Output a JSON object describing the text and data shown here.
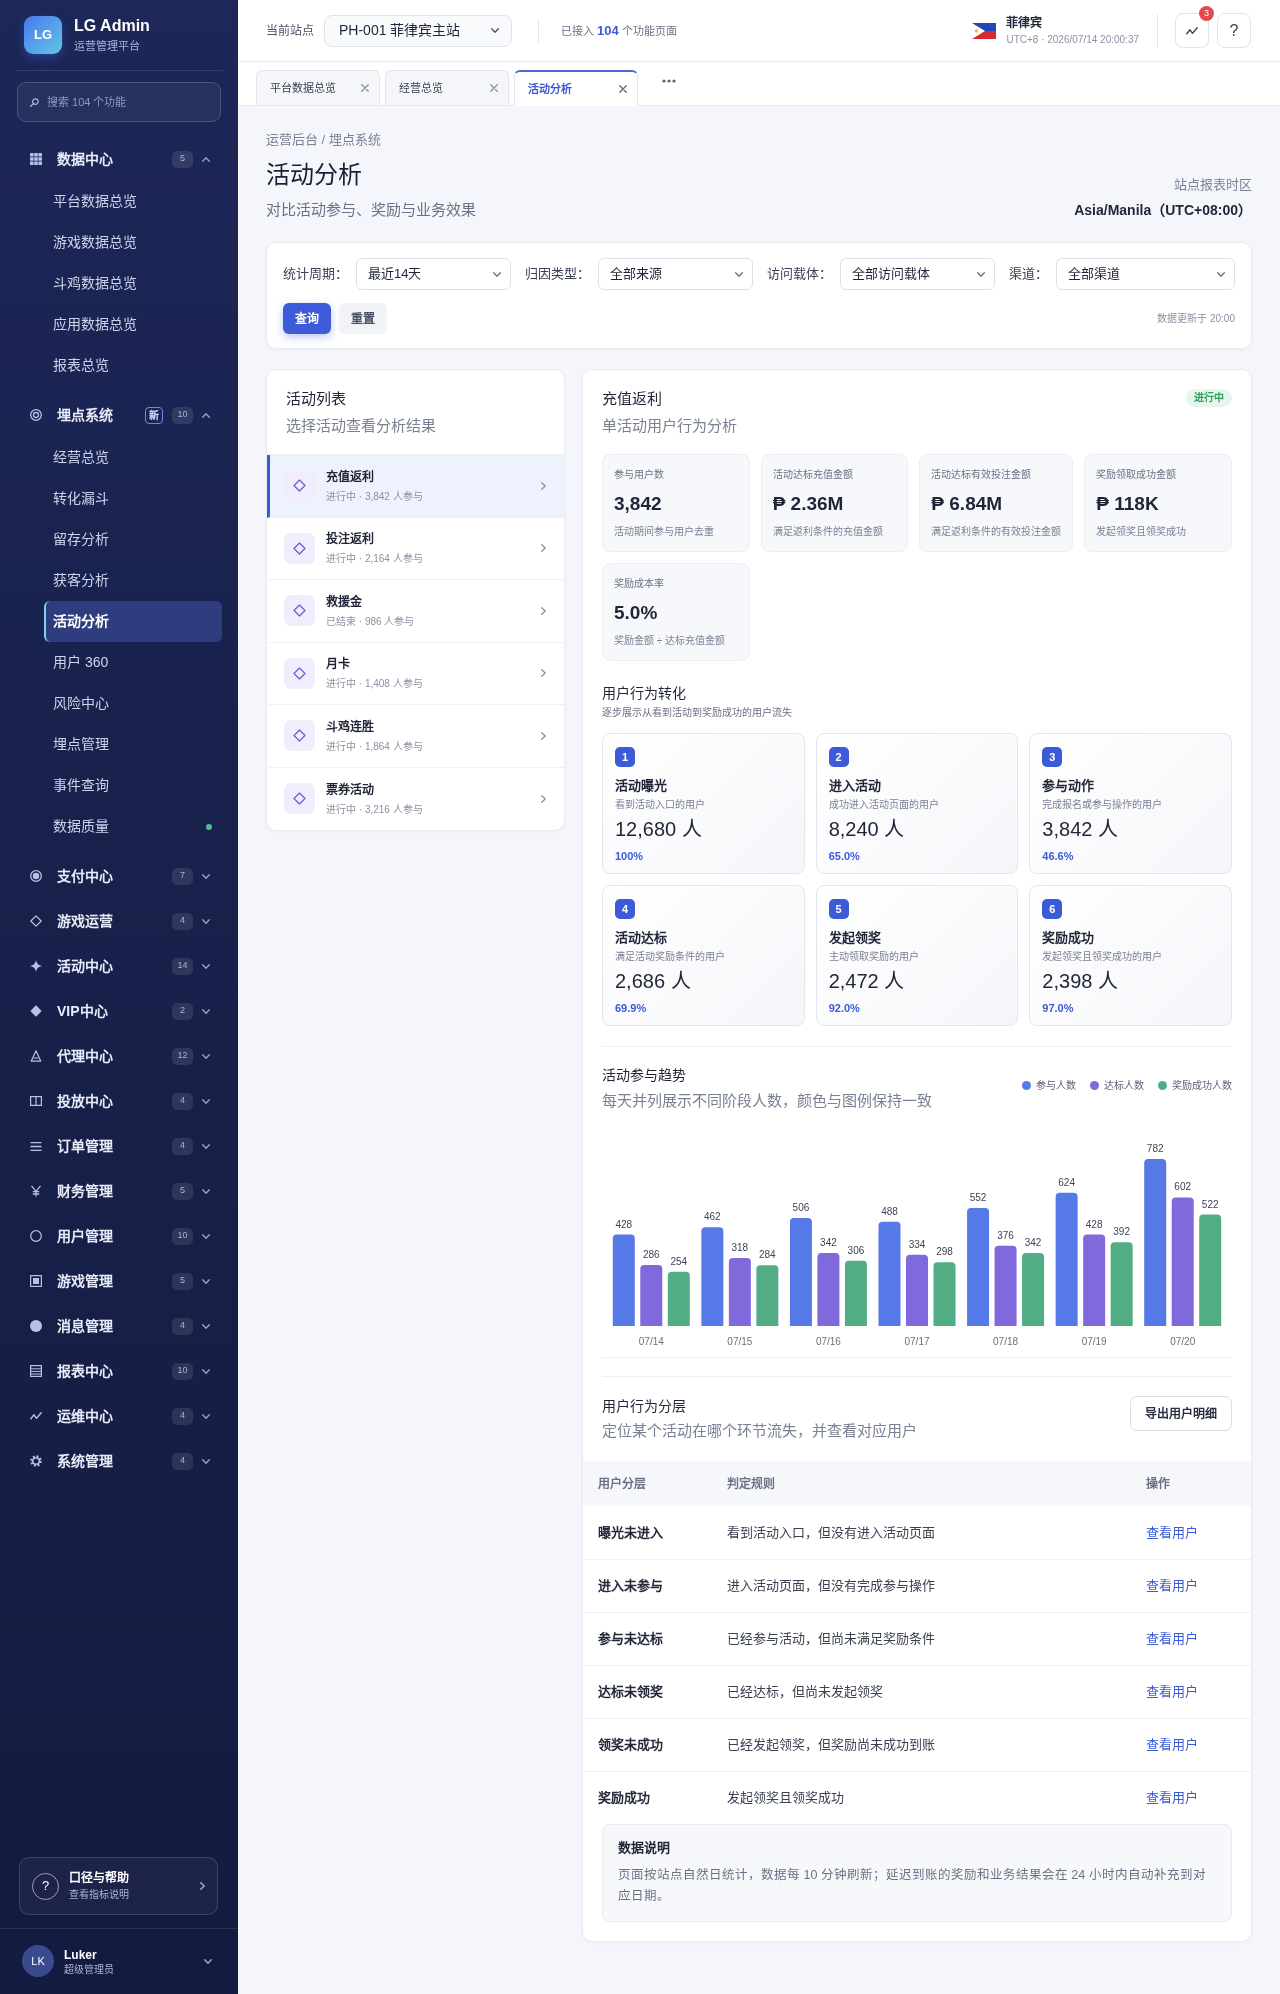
{
  "brand": {
    "logo": "LG",
    "name": "LG Admin",
    "subtitle": "运营管理平台"
  },
  "sidebar": {
    "search": {
      "placeholder": "搜索 104 个功能"
    },
    "groups": [
      {
        "label": "数据中心",
        "count": "5",
        "expanded": true,
        "children": [
          {
            "label": "平台数据总览",
            "selected": false
          },
          {
            "label": "游戏数据总览",
            "selected": false
          },
          {
            "label": "斗鸡数据总览",
            "selected": false
          },
          {
            "label": "应用数据总览",
            "selected": false
          },
          {
            "label": "报表总览",
            "selected": false
          }
        ]
      },
      {
        "label": "埋点系统",
        "tag": "新",
        "count": "10",
        "expanded": true,
        "children": [
          {
            "label": "经营总览",
            "selected": false,
            "dot": false
          },
          {
            "label": "转化漏斗",
            "selected": false,
            "dot": false
          },
          {
            "label": "留存分析",
            "selected": false,
            "dot": false
          },
          {
            "label": "获客分析",
            "selected": false,
            "dot": false
          },
          {
            "label": "活动分析",
            "selected": true,
            "dot": false
          },
          {
            "label": "用户 360",
            "selected": false,
            "dot": false
          },
          {
            "label": "风险中心",
            "selected": false,
            "dot": false
          },
          {
            "label": "埋点管理",
            "selected": false,
            "dot": false
          },
          {
            "label": "事件查询",
            "selected": false,
            "dot": false
          },
          {
            "label": "数据质量",
            "selected": false,
            "dot": true
          }
        ]
      },
      {
        "label": "支付中心",
        "count": "7",
        "expanded": false
      },
      {
        "label": "游戏运营",
        "count": "4",
        "expanded": false
      },
      {
        "label": "活动中心",
        "count": "14",
        "expanded": false
      },
      {
        "label": "VIP中心",
        "count": "2",
        "expanded": false
      },
      {
        "label": "代理中心",
        "count": "12",
        "expanded": false
      },
      {
        "label": "投放中心",
        "count": "4",
        "expanded": false
      },
      {
        "label": "订单管理",
        "count": "4",
        "expanded": false
      },
      {
        "label": "财务管理",
        "count": "5",
        "expanded": false
      },
      {
        "label": "用户管理",
        "count": "10",
        "expanded": false
      },
      {
        "label": "游戏管理",
        "count": "5",
        "expanded": false
      },
      {
        "label": "消息管理",
        "count": "4",
        "expanded": false
      },
      {
        "label": "报表中心",
        "count": "10",
        "expanded": false
      },
      {
        "label": "运维中心",
        "count": "4",
        "expanded": false
      },
      {
        "label": "系统管理",
        "count": "4",
        "expanded": false
      }
    ]
  },
  "help": {
    "mark": "?",
    "title": "口径与帮助",
    "subtitle": "查看指标说明"
  },
  "user": {
    "initials": "LK",
    "name": "Luker",
    "role": "超级管理员"
  },
  "header": {
    "site": {
      "label": "当前站点",
      "value": "PH-001 菲律宾主站"
    },
    "integration": "已接入 **104** 个功能页面",
    "region": {
      "name": "菲律宾",
      "time": "UTC+8 · 2026/07/14 20:00:37"
    },
    "notifications": {
      "count": "3"
    },
    "help_button": "?"
  },
  "tabs": [
    {
      "label": "平台数据总览",
      "selected": false
    },
    {
      "label": "经营总览",
      "selected": false
    },
    {
      "label": "活动分析",
      "selected": true
    }
  ],
  "page": {
    "breadcrumb": "运营后台 / 埋点系统",
    "title": "活动分析",
    "subtitle": "对比活动参与、奖励与业务效果",
    "timezone": {
      "label": "站点报表时区",
      "value": "Asia/Manila（UTC+08:00）"
    }
  },
  "filters": {
    "fields": [
      {
        "label": "统计周期：",
        "value": "最近14天"
      },
      {
        "label": "归因类型：",
        "value": "全部来源"
      },
      {
        "label": "访问载体：",
        "value": "全部访问载体"
      },
      {
        "label": "渠道：",
        "value": "全部渠道"
      }
    ],
    "buttons": [
      {
        "label": "查询",
        "kind": "primary"
      },
      {
        "label": "重置",
        "kind": "secondary"
      }
    ],
    "updated": "数据更新于 20:00"
  },
  "activities": {
    "title": "活动列表",
    "subtitle": "选择活动查看分析结果",
    "items": [
      {
        "name": "充值返利",
        "meta": "进行中 · 3,842 人参与",
        "selected": true
      },
      {
        "name": "投注返利",
        "meta": "进行中 · 2,164 人参与",
        "selected": false
      },
      {
        "name": "救援金",
        "meta": "已结束 · 986 人参与",
        "selected": false
      },
      {
        "name": "月卡",
        "meta": "进行中 · 1,408 人参与",
        "selected": false
      },
      {
        "name": "斗鸡连胜",
        "meta": "进行中 · 1,864 人参与",
        "selected": false
      },
      {
        "name": "票券活动",
        "meta": "进行中 · 3,216 人参与",
        "selected": false
      }
    ]
  },
  "detail": {
    "title": "充值返利",
    "subtitle": "单活动用户行为分析",
    "status": "进行中",
    "kpis": [
      {
        "label": "参与用户数",
        "value": "3,842",
        "note": "活动期间参与用户去重"
      },
      {
        "label": "活动达标充值金额",
        "value": "₱ 2.36M",
        "note": "满足返利条件的充值金额"
      },
      {
        "label": "活动达标有效投注金额",
        "value": "₱ 6.84M",
        "note": "满足返利条件的有效投注金额"
      },
      {
        "label": "奖励领取成功金额",
        "value": "₱ 118K",
        "note": "发起领奖且领奖成功"
      },
      {
        "label": "奖励成本率",
        "value": "5.0%",
        "note": "奖励金额 ÷ 达标充值金额"
      }
    ],
    "funnel": {
      "title": "用户行为转化",
      "subtitle": "逐步展示从看到活动到奖励成功的用户流失",
      "steps": [
        {
          "number": "1",
          "name": "活动曝光",
          "description": "看到活动入口的用户",
          "count": "12,680 人",
          "rate": "100%"
        },
        {
          "number": "2",
          "name": "进入活动",
          "description": "成功进入活动页面的用户",
          "count": "8,240 人",
          "rate": "65.0%"
        },
        {
          "number": "3",
          "name": "参与动作",
          "description": "完成报名或参与操作的用户",
          "count": "3,842 人",
          "rate": "46.6%"
        },
        {
          "number": "4",
          "name": "活动达标",
          "description": "满足活动奖励条件的用户",
          "count": "2,686 人",
          "rate": "69.9%"
        },
        {
          "number": "5",
          "name": "发起领奖",
          "description": "主动领取奖励的用户",
          "count": "2,472 人",
          "rate": "92.0%"
        },
        {
          "number": "6",
          "name": "奖励成功",
          "description": "发起领奖且领奖成功的用户",
          "count": "2,398 人",
          "rate": "97.0%"
        }
      ]
    },
    "trend": {
      "title": "活动参与趋势",
      "subtitle": "每天并列展示不同阶段人数，颜色与图例保持一致",
      "chart_data": {
        "type": "bar",
        "categories": [
          "07/14",
          "07/15",
          "07/16",
          "07/17",
          "07/18",
          "07/19",
          "07/20"
        ],
        "series": [
          {
            "name": "参与人数",
            "color": "#5579e6",
            "values": [
              428,
              462,
              506,
              488,
              552,
              624,
              782
            ]
          },
          {
            "name": "达标人数",
            "color": "#8068dd",
            "values": [
              286,
              318,
              342,
              334,
              376,
              428,
              602
            ]
          },
          {
            "name": "奖励成功人数",
            "color": "#52ad85",
            "values": [
              254,
              284,
              306,
              298,
              342,
              392,
              522
            ]
          }
        ],
        "data_labels": true
      }
    },
    "segments": {
      "title": "用户行为分层",
      "subtitle": "定位某个活动在哪个环节流失，并查看对应用户",
      "export_button": "导出用户明细",
      "columns": [
        "用户分层",
        "判定规则",
        "操作"
      ],
      "rows": [
        {
          "segment": "曝光未进入",
          "rule": "看到活动入口，但没有进入活动页面",
          "action": "查看用户"
        },
        {
          "segment": "进入未参与",
          "rule": "进入活动页面，但没有完成参与操作",
          "action": "查看用户"
        },
        {
          "segment": "参与未达标",
          "rule": "已经参与活动，但尚未满足奖励条件",
          "action": "查看用户"
        },
        {
          "segment": "达标未领奖",
          "rule": "已经达标，但尚未发起领奖",
          "action": "查看用户"
        },
        {
          "segment": "领奖未成功",
          "rule": "已经发起领奖，但奖励尚未成功到账",
          "action": "查看用户"
        },
        {
          "segment": "奖励成功",
          "rule": "发起领奖且领奖成功",
          "action": "查看用户"
        }
      ]
    },
    "note": {
      "title": "数据说明",
      "text": "页面按站点自然日统计，数据每 10 分钟刷新；延迟到账的奖励和业务结果会在 24 小时内自动补充到对应日期。"
    }
  }
}
